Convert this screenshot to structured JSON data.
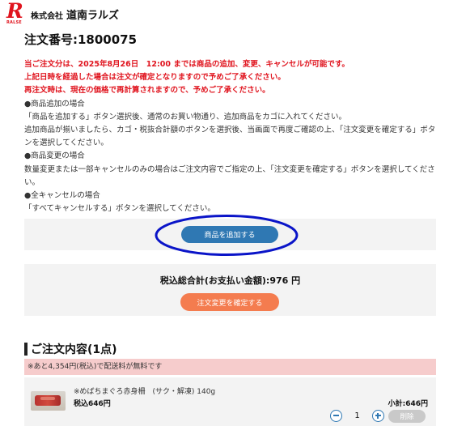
{
  "header": {
    "logo_letter": "R",
    "logo_sub": "RALSE",
    "company_prefix": "株式会社",
    "company_name": "道南ラルズ"
  },
  "order": {
    "title": "注文番号:1800075"
  },
  "notice": {
    "red_lines": [
      "当ご注文分は、2025年8月26日　12:00 までは商品の追加、変更、キャンセルが可能です。",
      "上記日時を経過した場合は注文が確定となりますので予めご了承ください。",
      "再注文時は、現在の価格で再計算されますので、予めご了承ください。"
    ],
    "add_heading": "●商品追加の場合",
    "add_text_1": "「商品を追加する」ボタン選択後、通常のお買い物通り、追加商品をカゴに入れてください。",
    "add_text_2": "追加商品が揃いましたら、カゴ・税抜合計額のボタンを選択後、当画面で再度ご確認の上、「注文変更を確定する」ボタンを選択してください。",
    "change_heading": "●商品変更の場合",
    "change_text": "数量変更または一部キャンセルのみの場合はご注文内容でご指定の上、「注文変更を確定する」ボタンを選択してください。",
    "cancel_heading": "●全キャンセルの場合",
    "cancel_text": "「すべてキャンセルする」ボタンを選択してください。"
  },
  "actions": {
    "add_label": "商品を追加する",
    "total_label": "税込総合計(お支払い金額):976 円",
    "confirm_label": "注文変更を確定する"
  },
  "order_contents": {
    "title": "ご注文内容(1点)",
    "shipping_note": "※あと4,354円(税込)で配送料が無料です",
    "items": [
      {
        "name": "※めばちまぐろ赤身柵　(サク・解凍) 140g",
        "price": "税込646円",
        "subtotal": "小計:646円",
        "quantity": "1",
        "delete_label": "削除"
      }
    ]
  },
  "colors": {
    "brand_red": "#e0141e",
    "add_button": "#2f78b3",
    "confirm_button": "#f47c4f",
    "highlight_ellipse": "#0a14c8",
    "shipping_note_bg": "#f6cccc"
  }
}
